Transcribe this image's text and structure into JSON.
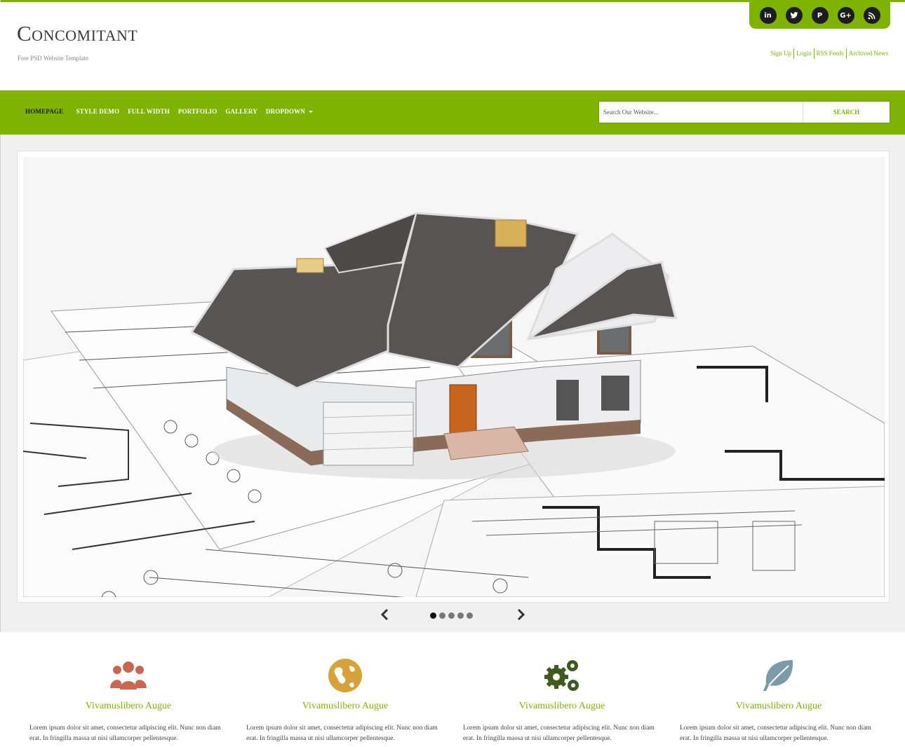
{
  "site": {
    "title": "Concomitant",
    "tagline": "Free PSD Website Template"
  },
  "colors": {
    "accent": "#7fb302",
    "dark": "#1d1d1d",
    "users_icon": "#c8664f",
    "globe_icon": "#d8a23a",
    "gears_icon": "#3f5a1c",
    "leaf_icon": "#7d9aa8"
  },
  "social": [
    {
      "icon": "linkedin-icon",
      "glyph": "in"
    },
    {
      "icon": "twitter-icon",
      "glyph": "t"
    },
    {
      "icon": "pinterest-icon",
      "glyph": "P"
    },
    {
      "icon": "google-plus-icon",
      "glyph": "G+"
    },
    {
      "icon": "rss-icon",
      "glyph": "≋"
    }
  ],
  "toplinks": [
    "Sign Up",
    "Login",
    "RSS Feeds",
    "Archived News"
  ],
  "nav": {
    "items": [
      "Homepage",
      "Style Demo",
      "Full Width",
      "Portfolio",
      "Gallery",
      "Dropdown"
    ],
    "active_index": 0
  },
  "search": {
    "placeholder": "Search Our Website...",
    "button": "Search"
  },
  "slider": {
    "image": "3D house model on architectural blueprints",
    "slides_count": 5,
    "active_slide": 1
  },
  "features": [
    {
      "icon": "users-icon",
      "title": "Vivamuslibero Augue",
      "text": "Lorem ipsum dolor sit amet, consectetur adipiscing elit. Nunc non diam erat. In fringilla massa ut nisi ullamcorper pellentesque."
    },
    {
      "icon": "globe-icon",
      "title": "Vivamuslibero Augue",
      "text": "Lorem ipsum dolor sit amet, consectetur adipiscing elit. Nunc non diam erat. In fringilla massa ut nisi ullamcorper pellentesque."
    },
    {
      "icon": "gears-icon",
      "title": "Vivamuslibero Augue",
      "text": "Lorem ipsum dolor sit amet, consectetur adipiscing elit. Nunc non diam erat. In fringilla massa ut nisi ullamcorper pellentesque."
    },
    {
      "icon": "leaf-icon",
      "title": "Vivamuslibero Augue",
      "text": "Lorem ipsum dolor sit amet, consectetur adipiscing elit. Nunc non diam erat. In fringilla massa ut nisi ullamcorper pellentesque."
    }
  ]
}
